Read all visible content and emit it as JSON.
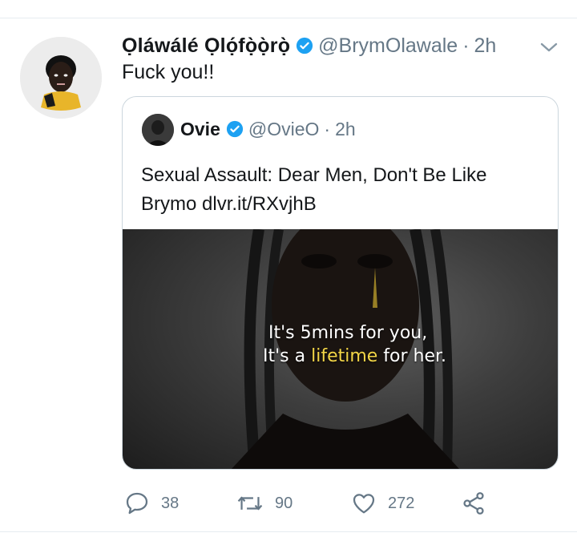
{
  "tweet": {
    "author_name": "Ọláwálé  Ọlọ́fọ̀ọ̀rọ̀",
    "handle": "@BrymOlawale",
    "separator": "·",
    "time": "2h",
    "text": "Fuck you!!"
  },
  "quote": {
    "author_name": "Ovie",
    "handle": "@OvieO",
    "separator": "·",
    "time": "2h",
    "text": "Sexual Assault: Dear Men, Don't Be Like Brymo dlvr.it/RXvjhB",
    "image": {
      "line1": "It's 5mins for you,",
      "line2_before": "It's a ",
      "line2_highlight": "lifetime",
      "line2_after": " for her."
    }
  },
  "actions": {
    "replies": "38",
    "retweets": "90",
    "likes": "272"
  },
  "colors": {
    "verified": "#1da1f2",
    "secondary_text": "#657786",
    "highlight_text": "#f2d547",
    "border": "#ccd6dd"
  },
  "icons": [
    "verified-badge-icon",
    "chevron-down-icon",
    "reply-icon",
    "retweet-icon",
    "like-icon",
    "share-icon"
  ]
}
